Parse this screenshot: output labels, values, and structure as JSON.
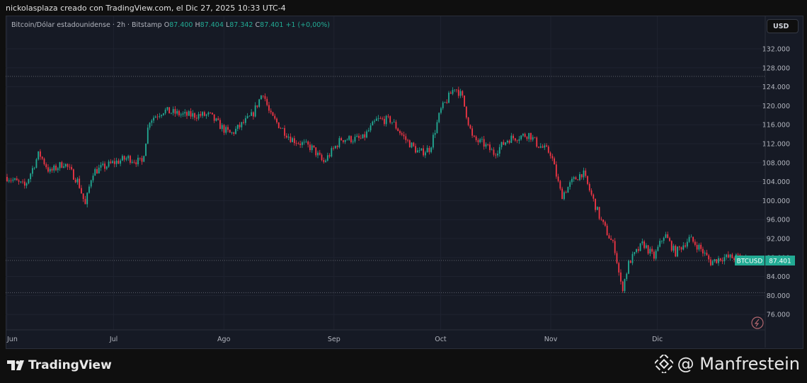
{
  "header": {
    "credit": "nickolasplaza creado con TradingView.com, el Dic 27, 2025 10:33 UTC-4"
  },
  "legend": {
    "symbol": "Bitcoin/Dólar estadounidense · 2h · Bitstamp",
    "o_label": "O",
    "o": "87.400",
    "h_label": "H",
    "h": "87.404",
    "l_label": "L",
    "l": "87.342",
    "c_label": "C",
    "c": "87.401",
    "change": "+1 (+0,00%)"
  },
  "currency_button": "USD",
  "price_tag": {
    "symbol": "BTCUSD",
    "price": "87.401"
  },
  "footer": {
    "brand": "TradingView",
    "handle": "@ Manfrestein"
  },
  "colors": {
    "up": "#22ab94",
    "down": "#f23645",
    "background": "#161a25"
  },
  "chart_data": {
    "type": "candlestick",
    "title": "Bitcoin/Dólar estadounidense · 2h · Bitstamp",
    "ylabel": "USD",
    "ylim": [
      72000,
      135000
    ],
    "y_ticks": [
      "132.000",
      "128.000",
      "124.000",
      "120.000",
      "116.000",
      "112.000",
      "108.000",
      "104.000",
      "100.000",
      "96.000",
      "92.000",
      "88.000",
      "84.000",
      "80.000",
      "76.000"
    ],
    "y_tick_values": [
      132000,
      128000,
      124000,
      120000,
      116000,
      112000,
      108000,
      104000,
      100000,
      96000,
      92000,
      88000,
      84000,
      80000,
      76000
    ],
    "x_ticks": [
      {
        "label": "Jun",
        "day": 0
      },
      {
        "label": "Jul",
        "day": 30
      },
      {
        "label": "Ago",
        "day": 61
      },
      {
        "label": "Sep",
        "day": 92
      },
      {
        "label": "Oct",
        "day": 122
      },
      {
        "label": "Nov",
        "day": 153
      },
      {
        "label": "Dic",
        "day": 183
      }
    ],
    "day_range": [
      0,
      210
    ],
    "reference_lines": {
      "high": 126200,
      "last": 87401,
      "low": 80600
    },
    "close_path_day_price": [
      [
        0,
        105000
      ],
      [
        5,
        103000
      ],
      [
        9,
        110000
      ],
      [
        12,
        106000
      ],
      [
        16,
        108000
      ],
      [
        20,
        104000
      ],
      [
        22,
        99000
      ],
      [
        24,
        106000
      ],
      [
        30,
        108000
      ],
      [
        34,
        109000
      ],
      [
        38,
        108000
      ],
      [
        40,
        117000
      ],
      [
        44,
        119000
      ],
      [
        50,
        118000
      ],
      [
        57,
        118000
      ],
      [
        61,
        115000
      ],
      [
        63,
        114000
      ],
      [
        69,
        118000
      ],
      [
        72,
        123000
      ],
      [
        74,
        118000
      ],
      [
        80,
        113000
      ],
      [
        86,
        111000
      ],
      [
        89,
        108000
      ],
      [
        94,
        113000
      ],
      [
        100,
        113000
      ],
      [
        104,
        117000
      ],
      [
        108,
        117000
      ],
      [
        112,
        113000
      ],
      [
        116,
        110000
      ],
      [
        119,
        111000
      ],
      [
        122,
        119000
      ],
      [
        126,
        124000
      ],
      [
        128,
        122000
      ],
      [
        131,
        113000
      ],
      [
        134,
        112000
      ],
      [
        137,
        110000
      ],
      [
        141,
        113000
      ],
      [
        147,
        114000
      ],
      [
        149,
        112000
      ],
      [
        153,
        110000
      ],
      [
        156,
        101000
      ],
      [
        159,
        104000
      ],
      [
        162,
        106000
      ],
      [
        164,
        102000
      ],
      [
        167,
        96000
      ],
      [
        171,
        90000
      ],
      [
        173,
        81000
      ],
      [
        175,
        87000
      ],
      [
        179,
        91000
      ],
      [
        182,
        88000
      ],
      [
        185,
        93000
      ],
      [
        188,
        89000
      ],
      [
        192,
        92000
      ],
      [
        195,
        90000
      ],
      [
        198,
        87000
      ],
      [
        201,
        88000
      ],
      [
        207,
        88000
      ],
      [
        209,
        87401
      ]
    ]
  }
}
